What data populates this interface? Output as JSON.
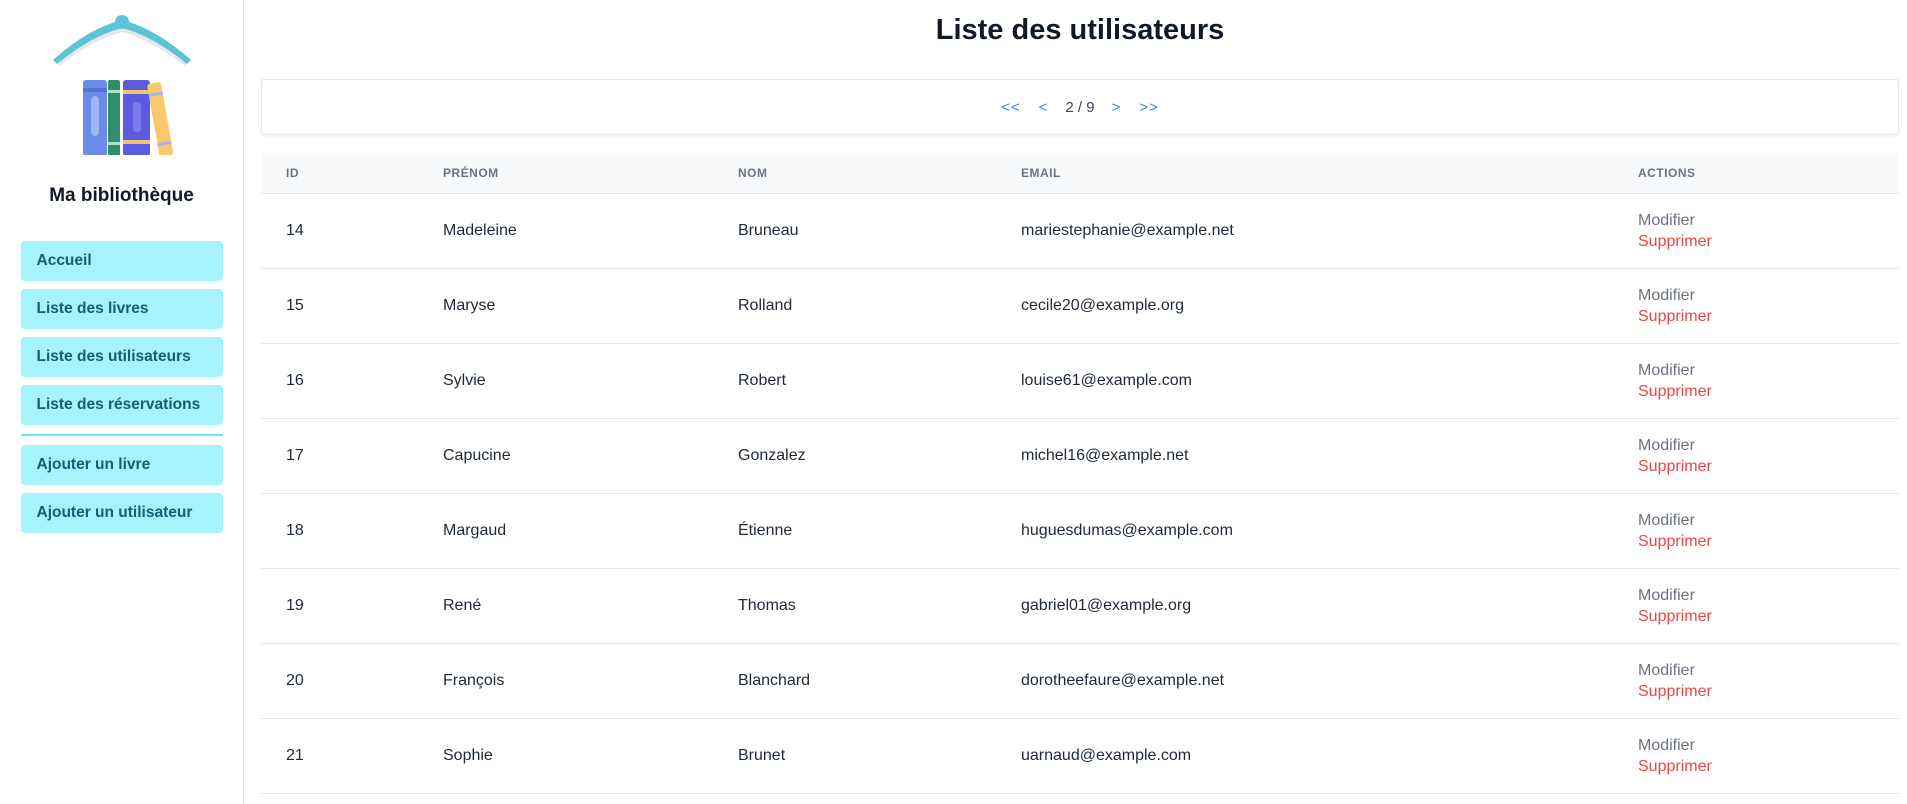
{
  "sidebar": {
    "brand": "Ma bibliothèque",
    "nav": [
      {
        "label": "Accueil"
      },
      {
        "label": "Liste des livres"
      },
      {
        "label": "Liste des utilisateurs"
      },
      {
        "label": "Liste des réservations"
      }
    ],
    "nav_secondary": [
      {
        "label": "Ajouter un livre"
      },
      {
        "label": "Ajouter un utilisateur"
      }
    ]
  },
  "main": {
    "title": "Liste des utilisateurs",
    "pagination": {
      "first": "<<",
      "prev": "<",
      "current": "2 / 9",
      "next": ">",
      "last": ">>"
    },
    "table": {
      "headers": [
        "ID",
        "PRÉNOM",
        "NOM",
        "EMAIL",
        "ACTIONS"
      ],
      "edit_label": "Modifier",
      "delete_label": "Supprimer",
      "rows": [
        {
          "id": "14",
          "prenom": "Madeleine",
          "nom": "Bruneau",
          "email": "mariestephanie@example.net"
        },
        {
          "id": "15",
          "prenom": "Maryse",
          "nom": "Rolland",
          "email": "cecile20@example.org"
        },
        {
          "id": "16",
          "prenom": "Sylvie",
          "nom": "Robert",
          "email": "louise61@example.com"
        },
        {
          "id": "17",
          "prenom": "Capucine",
          "nom": "Gonzalez",
          "email": "michel16@example.net"
        },
        {
          "id": "18",
          "prenom": "Margaud",
          "nom": "Étienne",
          "email": "huguesdumas@example.com"
        },
        {
          "id": "19",
          "prenom": "René",
          "nom": "Thomas",
          "email": "gabriel01@example.org"
        },
        {
          "id": "20",
          "prenom": "François",
          "nom": "Blanchard",
          "email": "dorotheefaure@example.net"
        },
        {
          "id": "21",
          "prenom": "Sophie",
          "nom": "Brunet",
          "email": "uarnaud@example.com"
        }
      ]
    }
  },
  "colors": {
    "nav_bg": "#a5f3fc",
    "nav_text": "#155e75",
    "link_blue": "#3b82f6",
    "delete_red": "#ef4444"
  }
}
